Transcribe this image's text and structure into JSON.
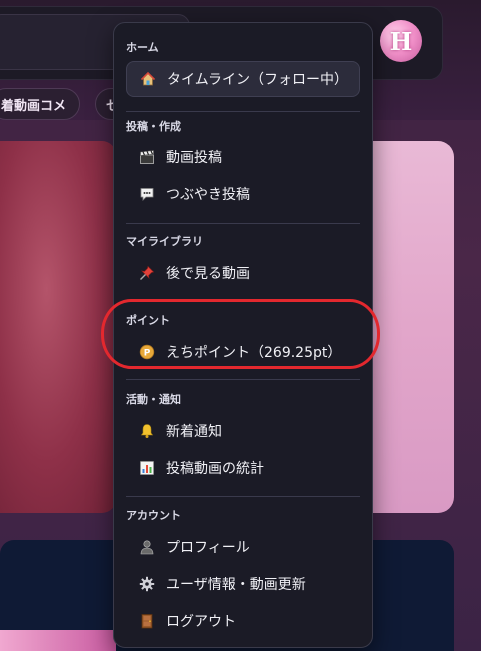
{
  "header": {
    "avatar_letter": "H"
  },
  "chips": {
    "chip1_label": "着動画コメ",
    "chip2_label": "セ"
  },
  "menu": {
    "sections": [
      {
        "label": "ホーム",
        "items": [
          {
            "label": "タイムライン（フォロー中）",
            "icon": "house-icon",
            "active": true
          }
        ]
      },
      {
        "label": "投稿・作成",
        "items": [
          {
            "label": "動画投稿",
            "icon": "clapper-icon"
          },
          {
            "label": "つぶやき投稿",
            "icon": "speech-bubble-icon"
          }
        ]
      },
      {
        "label": "マイライブラリ",
        "items": [
          {
            "label": "後で見る動画",
            "icon": "pushpin-icon"
          }
        ]
      },
      {
        "label": "ポイント",
        "items": [
          {
            "label": "えちポイント（269.25pt）",
            "icon": "point-coin-icon"
          }
        ]
      },
      {
        "label": "活動・通知",
        "items": [
          {
            "label": "新着通知",
            "icon": "bell-icon"
          },
          {
            "label": "投稿動画の統計",
            "icon": "bar-chart-icon"
          }
        ]
      },
      {
        "label": "アカウント",
        "items": [
          {
            "label": "プロフィール",
            "icon": "user-icon"
          },
          {
            "label": "ユーザ情報・動画更新",
            "icon": "gear-icon"
          },
          {
            "label": "ログアウト",
            "icon": "door-icon"
          }
        ]
      }
    ]
  },
  "colors": {
    "menu_bg": "#1b1b26",
    "highlight_ring": "#e3282e",
    "point_coin": "#e8a93a"
  }
}
